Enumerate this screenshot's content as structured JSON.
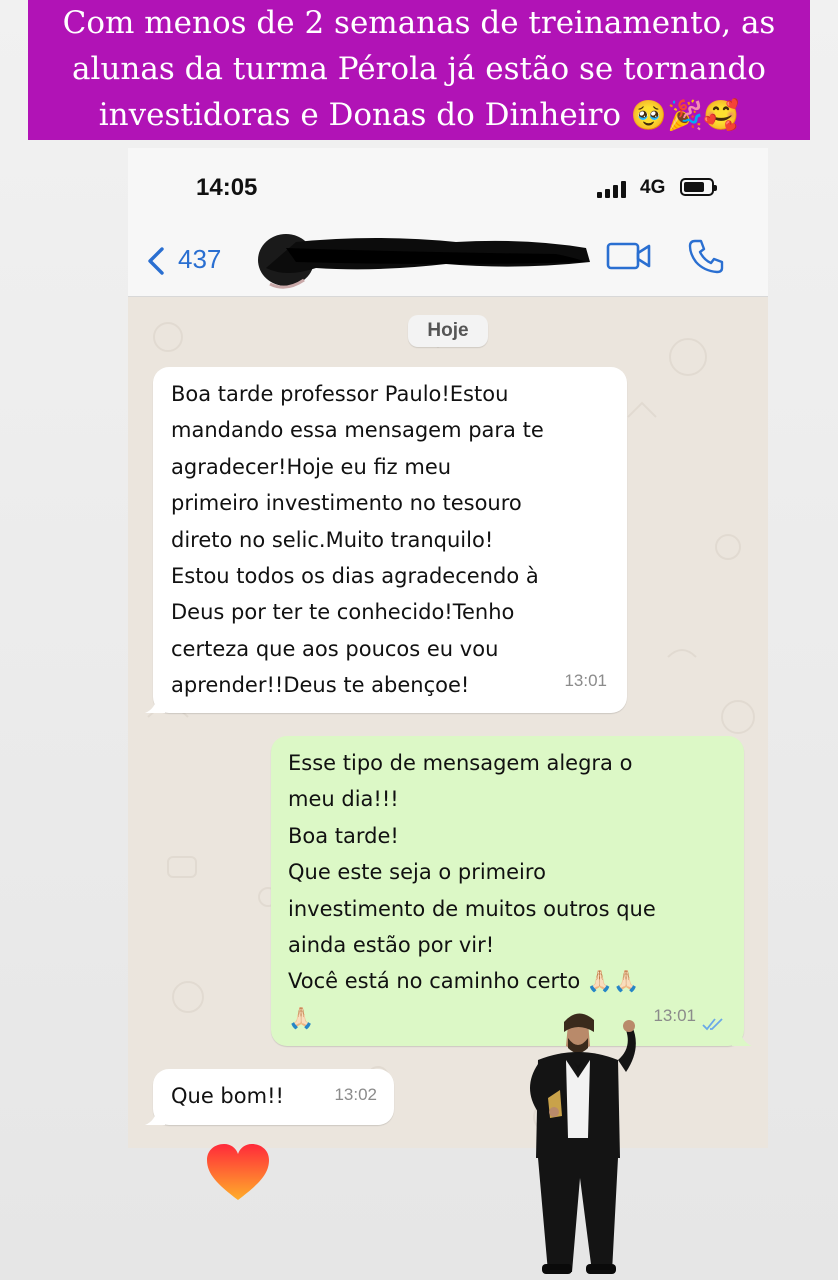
{
  "banner": {
    "lines": [
      "Com menos de 2 semanas de treinamento, as",
      "alunas da turma Pérola já estão se tornando",
      "investidoras e Donas do Dinheiro"
    ],
    "emojis": "🥹🎉🥰"
  },
  "status_bar": {
    "time": "14:05",
    "network": "4G"
  },
  "chat_header": {
    "back_count": "437",
    "icons": [
      "chevron-left-icon",
      "video-call-icon",
      "phone-call-icon"
    ]
  },
  "chat": {
    "date_label": "Hoje",
    "messages": [
      {
        "direction": "incoming",
        "lines": [
          "Boa tarde professor Paulo!Estou",
          "mandando essa mensagem para te",
          "agradecer!Hoje eu fiz meu",
          "primeiro investimento no tesouro",
          "direto no selic.Muito tranquilo!",
          "Estou todos os dias agradecendo à",
          "Deus por ter te conhecido!Tenho",
          "certeza que aos poucos eu vou",
          "aprender!!Deus te abençoe!"
        ],
        "time": "13:01"
      },
      {
        "direction": "outgoing",
        "lines": [
          "Esse tipo de mensagem alegra o",
          "meu dia!!!",
          "Boa tarde!",
          "Que este seja o primeiro",
          "investimento de muitos outros que",
          "ainda estão por vir!",
          "Você está no caminho certo 🙏🏻🙏🏻",
          "🙏🏻"
        ],
        "time": "13:01",
        "read_receipt": "double-check-icon"
      },
      {
        "direction": "incoming",
        "lines": [
          "Que bom!!"
        ],
        "time": "13:02"
      }
    ]
  },
  "colors": {
    "banner": "#b113b6",
    "accent_blue": "#2a6fd1",
    "incoming_bubble": "#ffffff",
    "outgoing_bubble": "#dcf8c6",
    "chat_background": "#ebe5dd"
  },
  "stickers": [
    "heart-icon",
    "celebrating-person-sticker"
  ]
}
